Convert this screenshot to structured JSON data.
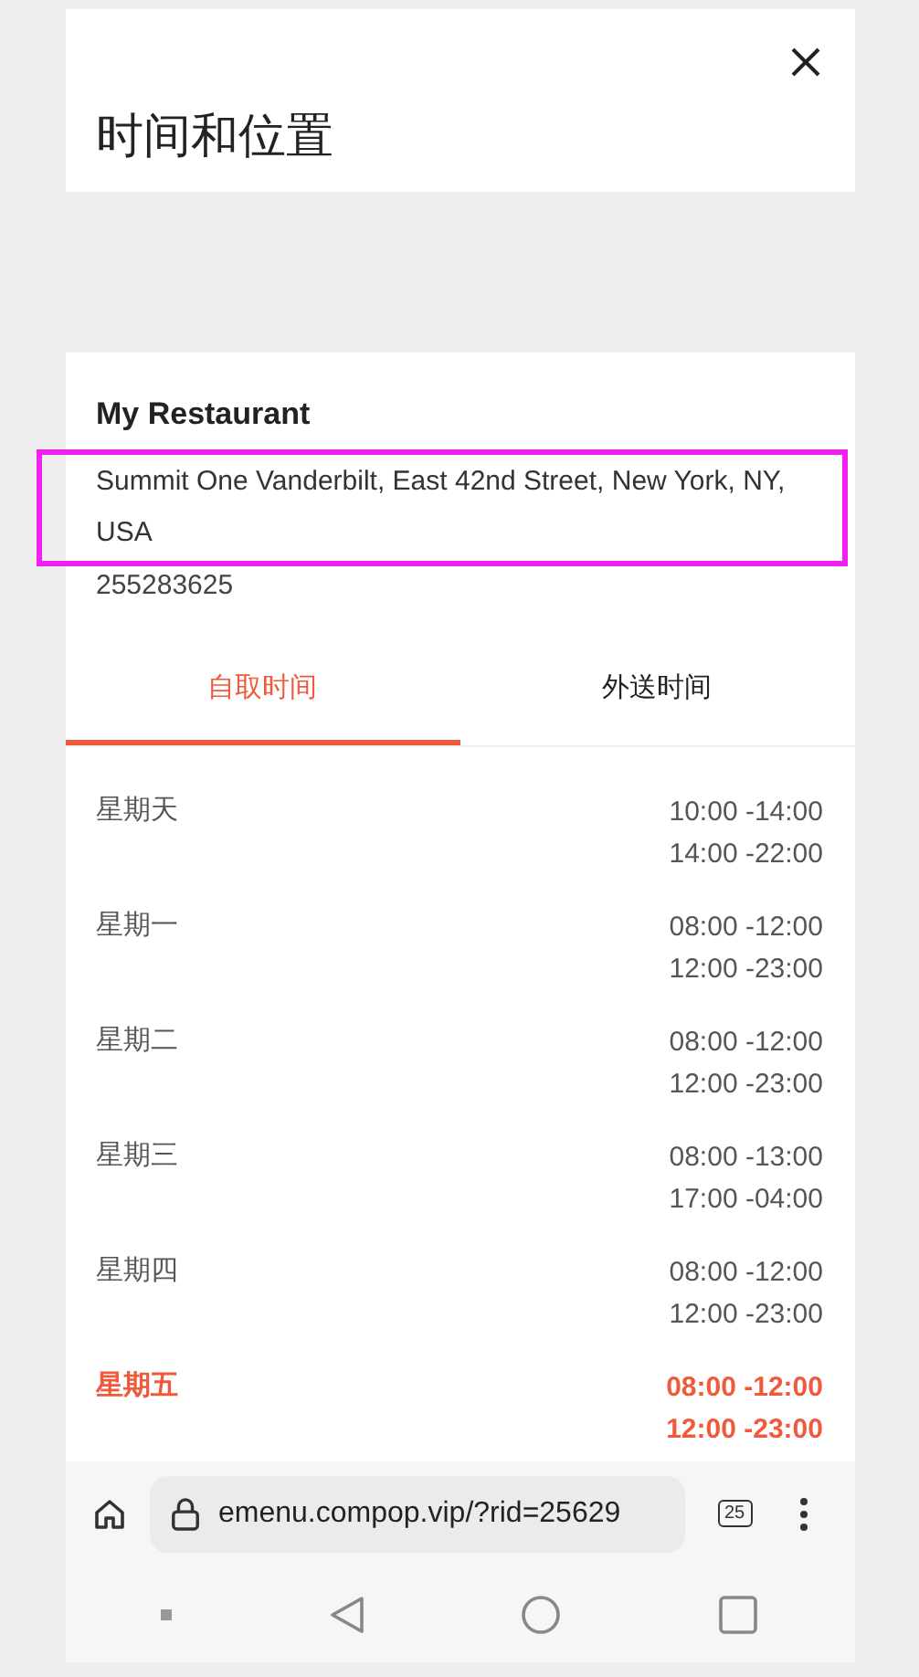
{
  "header": {
    "title": "时间和位置"
  },
  "restaurant": {
    "name": "My Restaurant",
    "address": "Summit One Vanderbilt, East 42nd Street, New York, NY, USA",
    "address_highlighted": true,
    "phone": "255283625"
  },
  "tabs": [
    {
      "label": "自取时间",
      "selected": true
    },
    {
      "label": "外送时间",
      "selected": false
    }
  ],
  "days": [
    {
      "day": "星期天",
      "today": false,
      "hours": [
        "10:00 -14:00",
        "14:00 -22:00"
      ]
    },
    {
      "day": "星期一",
      "today": false,
      "hours": [
        "08:00 -12:00",
        "12:00 -23:00"
      ]
    },
    {
      "day": "星期二",
      "today": false,
      "hours": [
        "08:00 -12:00",
        "12:00 -23:00"
      ]
    },
    {
      "day": "星期三",
      "today": false,
      "hours": [
        "08:00 -13:00",
        "17:00 -04:00"
      ]
    },
    {
      "day": "星期四",
      "today": false,
      "hours": [
        "08:00 -12:00",
        "12:00 -23:00"
      ]
    },
    {
      "day": "星期五",
      "today": true,
      "hours": [
        "08:00 -12:00",
        "12:00 -23:00"
      ]
    }
  ],
  "browser": {
    "url": "emenu.compop.vip/?rid=25629",
    "tab_count": "25"
  }
}
